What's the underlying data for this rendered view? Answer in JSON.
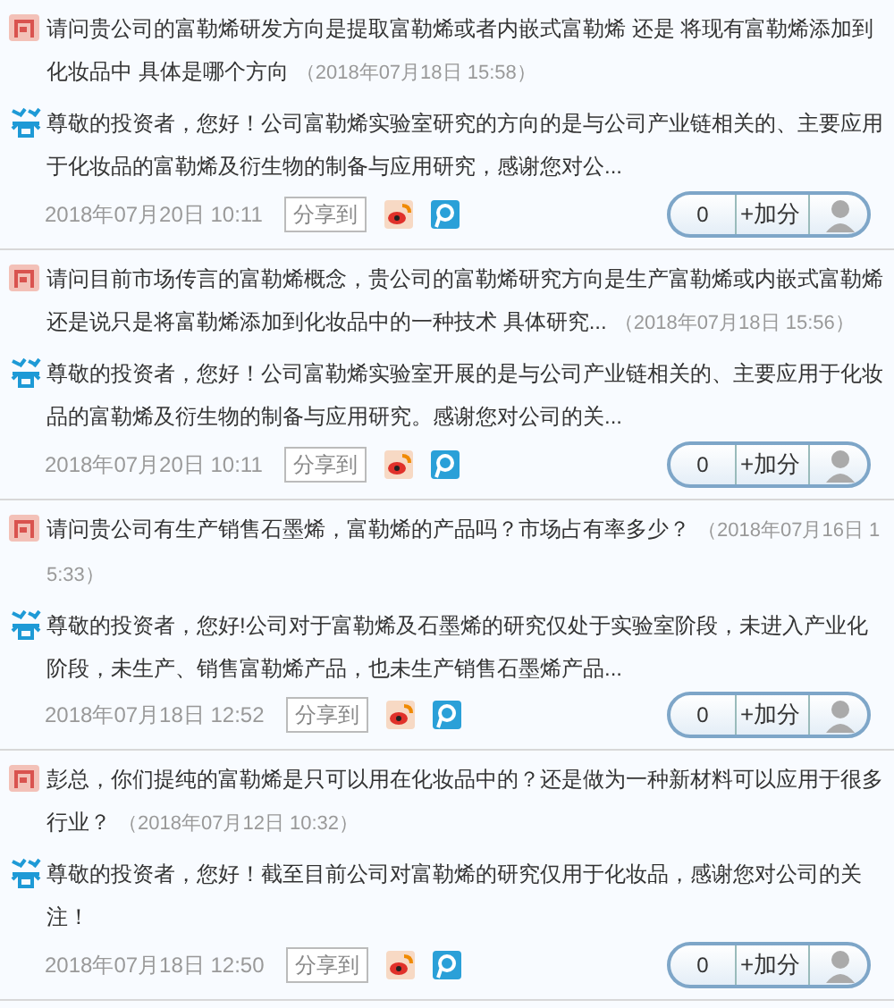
{
  "items": [
    {
      "question": "请问贵公司的富勒烯研发方向是提取富勒烯或者内嵌式富勒烯 还是 将现有富勒烯添加到化妆品中 具体是哪个方向",
      "question_time": "（2018年07月18日 15:58）",
      "answer": "尊敬的投资者，您好！公司富勒烯实验室研究的方向的是与公司产业链相关的、主要应用于化妆品的富勒烯及衍生物的制备与应用研究，感谢您对公...",
      "answer_time": "2018年07月20日 10:11",
      "share": "分享到",
      "score": "0",
      "add": "+加分"
    },
    {
      "question": "请问目前市场传言的富勒烯概念，贵公司的富勒烯研究方向是生产富勒烯或内嵌式富勒烯还是说只是将富勒烯添加到化妆品中的一种技术 具体研究...",
      "question_time": "（2018年07月18日 15:56）",
      "answer": "尊敬的投资者，您好！公司富勒烯实验室开展的是与公司产业链相关的、主要应用于化妆品的富勒烯及衍生物的制备与应用研究。感谢您对公司的关...",
      "answer_time": "2018年07月20日 10:11",
      "share": "分享到",
      "score": "0",
      "add": "+加分"
    },
    {
      "question": "请问贵公司有生产销售石墨烯，富勒烯的产品吗？市场占有率多少？",
      "question_time": "（2018年07月16日 15:33）",
      "answer": "尊敬的投资者，您好!公司对于富勒烯及石墨烯的研究仅处于实验室阶段，未进入产业化阶段，未生产、销售富勒烯产品，也未生产销售石墨烯产品...",
      "answer_time": "2018年07月18日 12:52",
      "share": "分享到",
      "score": "0",
      "add": "+加分"
    },
    {
      "question": "彭总，你们提纯的富勒烯是只可以用在化妆品中的？还是做为一种新材料可以应用于很多行业？",
      "question_time": "（2018年07月12日 10:32）",
      "answer": "尊敬的投资者，您好！截至目前公司对富勒烯的研究仅用于化妆品，感谢您对公司的关注！",
      "answer_time": "2018年07月18日 12:50",
      "share": "分享到",
      "score": "0",
      "add": "+加分"
    }
  ]
}
